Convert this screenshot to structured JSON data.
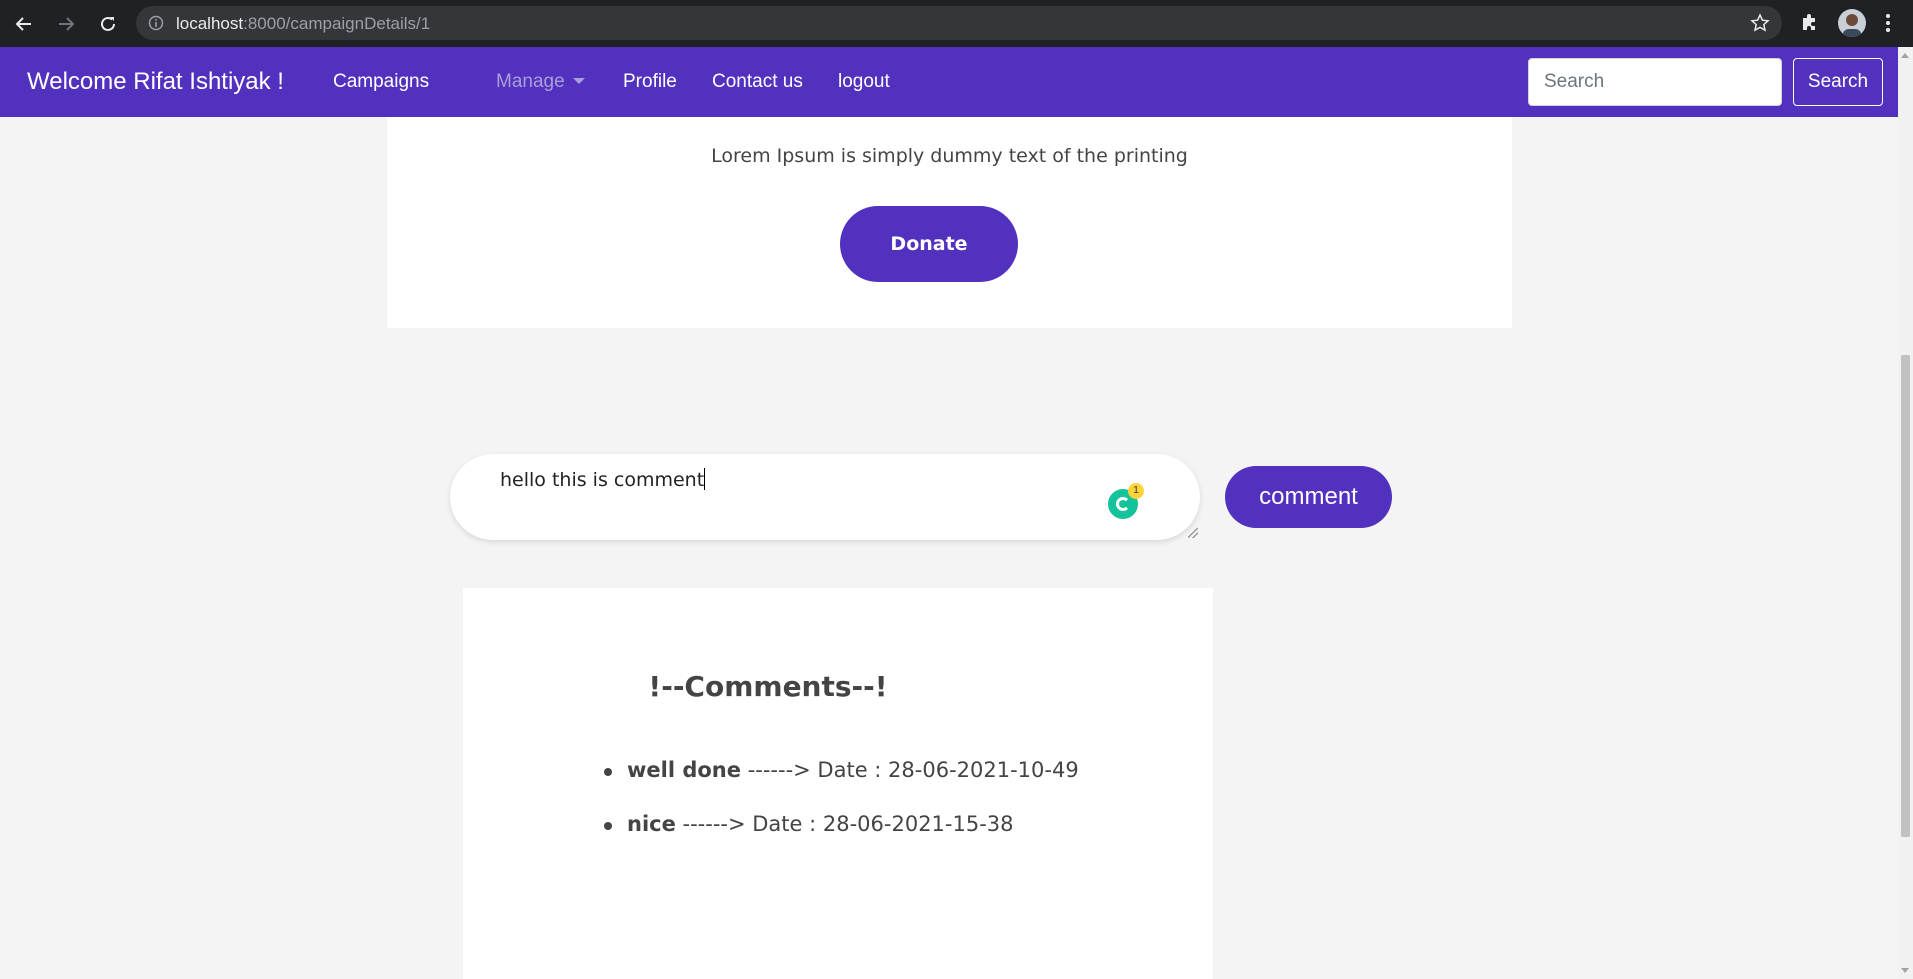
{
  "browser": {
    "url_host": "localhost",
    "url_path": ":8000/campaignDetails/1"
  },
  "navbar": {
    "brand": "Welcome Rifat Ishtiyak !",
    "links": [
      "Campaigns",
      "Manage",
      "Profile",
      "Contact us",
      "logout"
    ],
    "search_placeholder": "Search",
    "search_button": "Search"
  },
  "campaign": {
    "description": "Lorem Ipsum is simply dummy text of the printing",
    "donate_label": "Donate"
  },
  "comment_form": {
    "value": "hello this is comment",
    "grammarly_count": "1",
    "submit_label": "comment"
  },
  "comments": {
    "title": "!--Comments--!",
    "items": [
      {
        "text": "well done",
        "meta": " ------> Date : 28-06-2021-10-49"
      },
      {
        "text": "nice",
        "meta": " ------> Date : 28-06-2021-15-38"
      }
    ]
  },
  "colors": {
    "brand": "#5231bf",
    "chrome": "#202124"
  }
}
